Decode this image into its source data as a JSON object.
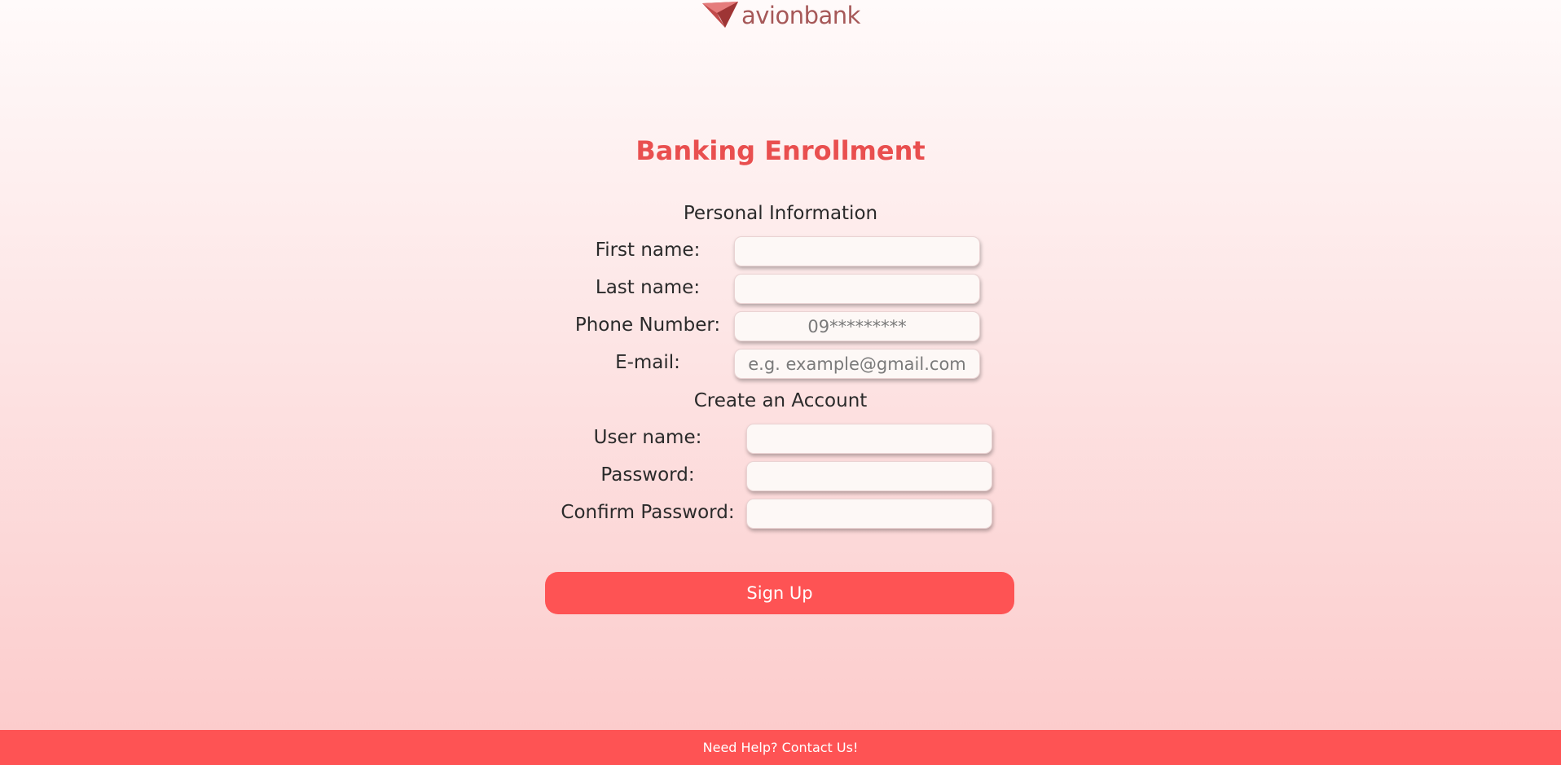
{
  "brand": {
    "name": "avionbank",
    "logo_icon": "paper-plane-logo-icon"
  },
  "page": {
    "title": "Banking Enrollment"
  },
  "personal": {
    "heading": "Personal Information",
    "first_name_label": "First name:",
    "last_name_label": "Last name:",
    "phone_label": "Phone Number:",
    "phone_placeholder": "09*********",
    "email_label": "E-mail:",
    "email_placeholder": "e.g. example@gmail.com"
  },
  "account": {
    "heading": "Create an Account",
    "username_label": "User name:",
    "password_label": "Password:",
    "confirm_label": "Confirm Password:"
  },
  "actions": {
    "signup_label": "Sign Up"
  },
  "footer": {
    "help_link": "Need Help? Contact Us!"
  },
  "colors": {
    "accent": "#fe5354",
    "title": "#e94f4f",
    "logo": "#a65858"
  }
}
